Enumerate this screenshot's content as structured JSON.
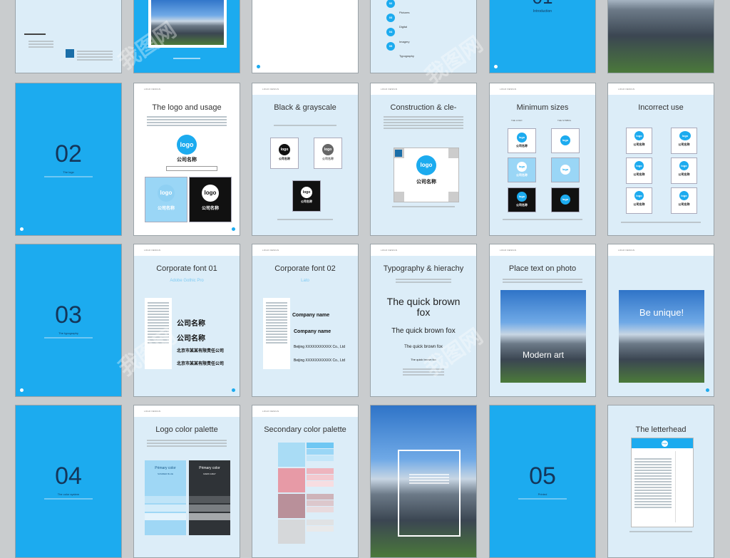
{
  "row1": {
    "p3_text": "",
    "p5_number": "01",
    "p5_label": "Introduction",
    "p4_items": [
      "Pictures",
      "Digital",
      "Imagery",
      "Typography"
    ]
  },
  "pages": {
    "logo_usage": {
      "title": "The logo and usage"
    },
    "black_grayscale": {
      "title": "Black & grayscale"
    },
    "construction": {
      "title": "Construction & cle-"
    },
    "minimum_sizes": {
      "title": "Minimum sizes",
      "col1": "THE LOGO",
      "col2": "THE SYMBOL"
    },
    "incorrect_use": {
      "title": "Incorrect use"
    },
    "corporate_font_01": {
      "title": "Corporate font 01",
      "subtitle": "Adobe Gothic Pro"
    },
    "corporate_font_02": {
      "title": "Corporate font 02",
      "subtitle": "Lato",
      "company1": "Company  name",
      "company2": "Company  name",
      "beijing1": "Beijing XXXXXXXXXXX Co., Ltd",
      "beijing2": "Beijing XXXXXXXXXXX Co., Ltd"
    },
    "typography_hierarchy": {
      "title": "Typography & hierachy",
      "quick1a": "The quick brown",
      "quick1b": "fox",
      "quick2": "The quick brown fox",
      "quick3": "The quick brown fox",
      "quick4": "The quick brown fox"
    },
    "place_text_photo": {
      "title": "Place text on photo",
      "overlay": "Modern art"
    },
    "be_unique": {
      "overlay": "Be unique!"
    },
    "logo_color_palette": {
      "title": "Logo color palette",
      "primary1": "Primary color",
      "primary1_name": "SUMMER BLUE",
      "primary2": "Primary color",
      "primary2_name": "DARK GRAY"
    },
    "secondary_palette": {
      "title": "Secondary color palette"
    },
    "letterhead": {
      "title": "The letterhead"
    }
  },
  "sections": [
    {
      "number": "02",
      "label": "The logo"
    },
    {
      "number": "03",
      "label": "The typography"
    },
    {
      "number": "04",
      "label": "The color system"
    },
    {
      "number": "05",
      "label": "Printed"
    }
  ],
  "logo": {
    "text": "logo",
    "company_cn": "公司名称",
    "company_cn_full": "北京市某某有限责任公司"
  },
  "watermark": "我图网",
  "colors": {
    "accent": "#1cabef",
    "dark": "#14365a",
    "palette": [
      "#1cabef",
      "#2f3337",
      "#e79aa6",
      "#a9d7f0",
      "#b9909a",
      "#dfe1e3"
    ]
  }
}
